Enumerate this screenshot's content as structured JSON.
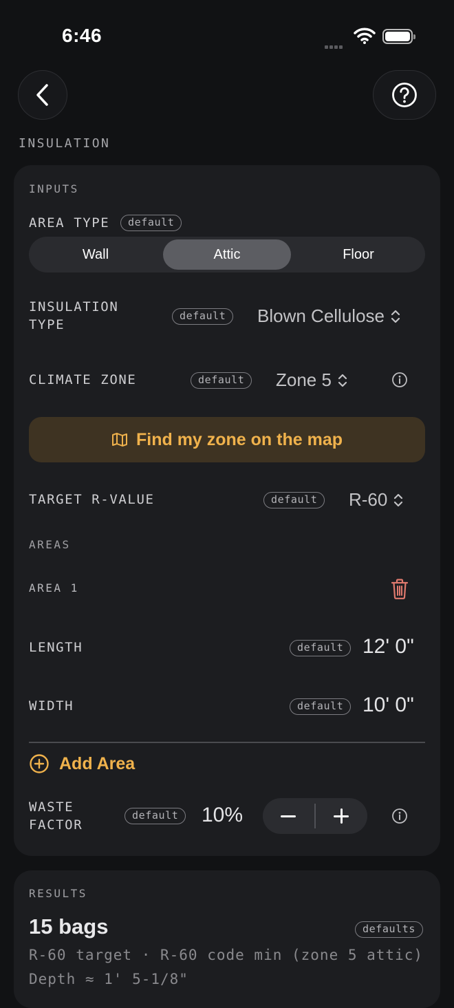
{
  "status_bar": {
    "time": "6:46"
  },
  "header": {
    "title": "INSULATION"
  },
  "inputs": {
    "section_label": "INPUTS",
    "default_badge": "default",
    "area_type": {
      "label": "AREA TYPE",
      "options": [
        "Wall",
        "Attic",
        "Floor"
      ],
      "selected": "Attic"
    },
    "insulation_type": {
      "label_line1": "INSULATION",
      "label_line2": "TYPE",
      "value": "Blown Cellulose"
    },
    "climate_zone": {
      "label": "CLIMATE ZONE",
      "value": "Zone 5"
    },
    "map_button": {
      "label": "Find my zone on the map"
    },
    "target_r_value": {
      "label": "TARGET R-VALUE",
      "value": "R-60"
    },
    "areas": {
      "section_label": "AREAS",
      "items": [
        {
          "title": "AREA 1",
          "length_label": "LENGTH",
          "length_value": "12' 0\"",
          "width_label": "WIDTH",
          "width_value": "10' 0\""
        }
      ],
      "add_label": "Add Area"
    },
    "waste_factor": {
      "label_line1": "WASTE",
      "label_line2": "FACTOR",
      "value": "10%"
    }
  },
  "results": {
    "section_label": "RESULTS",
    "main": "15 bags",
    "badge": "defaults",
    "line1": "R-60 target · R-60 code min (zone 5 attic)",
    "line2": "Depth ≈ 1' 5-1/8\""
  },
  "colors": {
    "accent": "#f0b24c",
    "danger": "#e07a6e",
    "card": "#1c1d20",
    "background": "#111214"
  }
}
